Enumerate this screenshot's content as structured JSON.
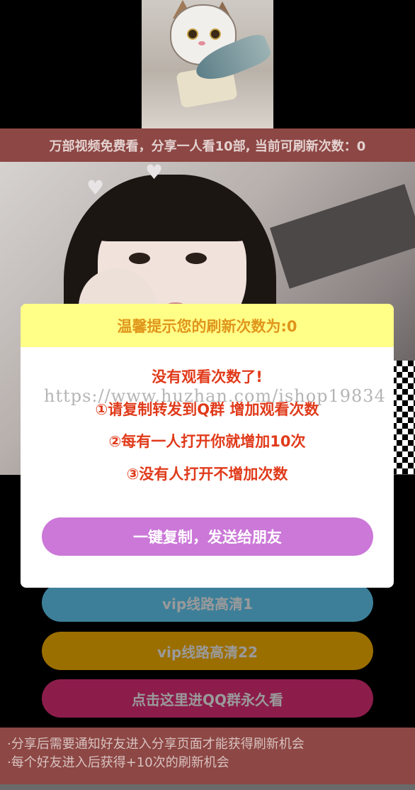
{
  "notice": {
    "text": "万部视频免费看，分享一人看10部, 当前可刷新次数：0"
  },
  "buttons": {
    "vip1": "vip线路高清1",
    "vip22": "vip线路高清22",
    "qq_group": "点击这里进QQ群永久看"
  },
  "footer": {
    "line1": "·分享后需要通知好友进入分享页面才能获得刷新机会",
    "line2": "·每个好友进入后获得+10次的刷新机会"
  },
  "modal": {
    "title": "温馨提示您的刷新次数为:0",
    "lines": [
      "没有观看次数了!",
      "①请复制转发到Q群 增加观看次数",
      "②每有一人打开你就增加10次",
      "③没有人打开不增加次数"
    ],
    "copy_button": "一键复制，发送给朋友"
  },
  "watermark": "https://www.huzhan.com/ishop19834",
  "colors": {
    "notice_bg": "#8d4744",
    "modal_header_bg": "#fffe87",
    "modal_header_text": "#e0951b",
    "modal_text": "#e03a1a",
    "copy_button_bg": "#cb78d8",
    "vip1_bg": "#3d7f99",
    "vip22_bg": "#9b6e00",
    "qq_bg": "#8c1d4b"
  }
}
